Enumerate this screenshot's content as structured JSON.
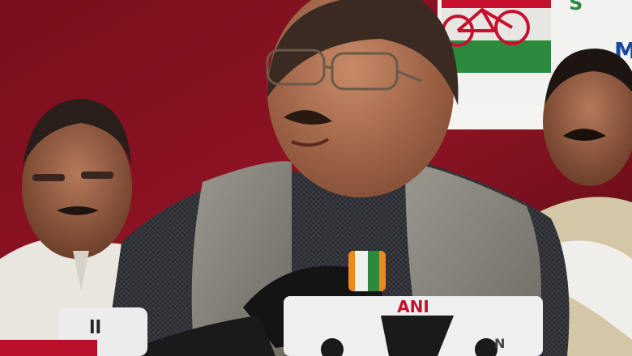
{
  "banner": {
    "text_right": "M",
    "text_top": "S"
  },
  "mics": {
    "ani_label": "ANI",
    "left_mic_label": "ll",
    "ndtv_label": "N"
  },
  "colors": {
    "backdrop": "#8a1020",
    "backdrop_dark": "#5c0a14",
    "banner_green": "#2b8a3e",
    "banner_red": "#c8102e",
    "vest": "#8d8a80",
    "shirt_dark": "#2b2b2e"
  }
}
